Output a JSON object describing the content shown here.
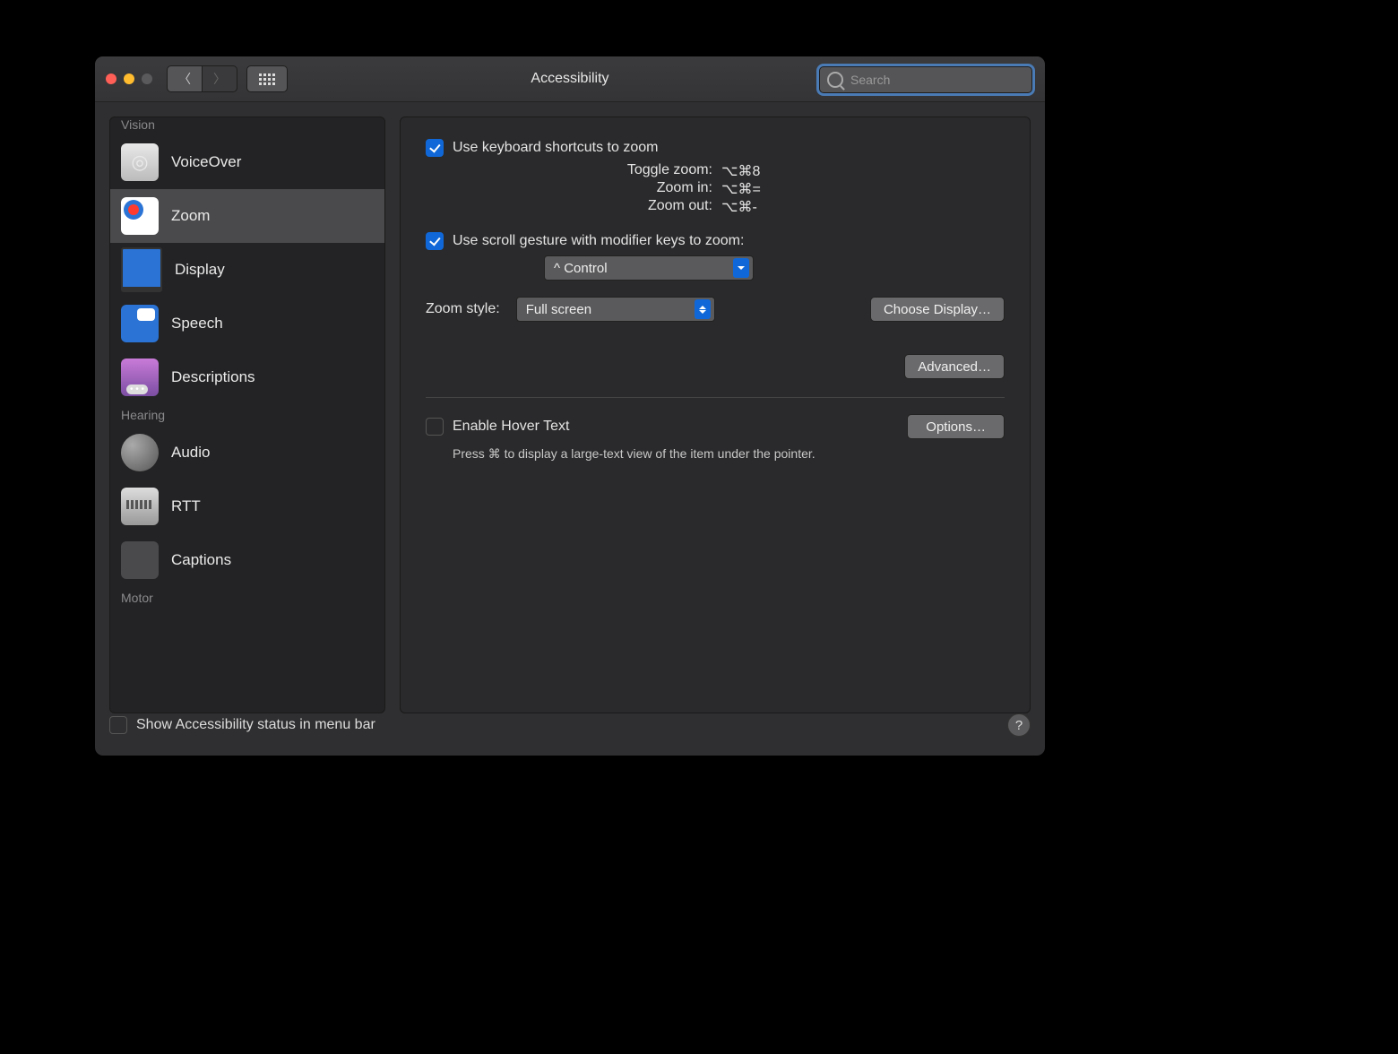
{
  "window": {
    "title": "Accessibility"
  },
  "search": {
    "placeholder": "Search"
  },
  "sidebar": {
    "sections": [
      {
        "label": "Vision",
        "items": [
          {
            "id": "voiceover",
            "label": "VoiceOver"
          },
          {
            "id": "zoom",
            "label": "Zoom",
            "selected": true
          },
          {
            "id": "display",
            "label": "Display"
          },
          {
            "id": "speech",
            "label": "Speech"
          },
          {
            "id": "descriptions",
            "label": "Descriptions"
          }
        ]
      },
      {
        "label": "Hearing",
        "items": [
          {
            "id": "audio",
            "label": "Audio"
          },
          {
            "id": "rtt",
            "label": "RTT"
          },
          {
            "id": "captions",
            "label": "Captions"
          }
        ]
      },
      {
        "label": "Motor",
        "items": []
      }
    ]
  },
  "main": {
    "kbd_shortcuts": {
      "checked": true,
      "label": "Use keyboard shortcuts to zoom",
      "rows": [
        {
          "label": "Toggle zoom:",
          "value": "⌥⌘8"
        },
        {
          "label": "Zoom in:",
          "value": "⌥⌘="
        },
        {
          "label": "Zoom out:",
          "value": "⌥⌘-"
        }
      ]
    },
    "scroll_gesture": {
      "checked": true,
      "label": "Use scroll gesture with modifier keys to zoom:",
      "modifier": "^ Control"
    },
    "zoom_style": {
      "label": "Zoom style:",
      "value": "Full screen"
    },
    "choose_display": "Choose Display…",
    "advanced": "Advanced…",
    "hover": {
      "checked": false,
      "label": "Enable Hover Text",
      "options": "Options…",
      "hint": "Press ⌘ to display a large-text view of the item under the pointer."
    }
  },
  "footer": {
    "show_status": {
      "checked": false,
      "label": "Show Accessibility status in menu bar"
    }
  }
}
